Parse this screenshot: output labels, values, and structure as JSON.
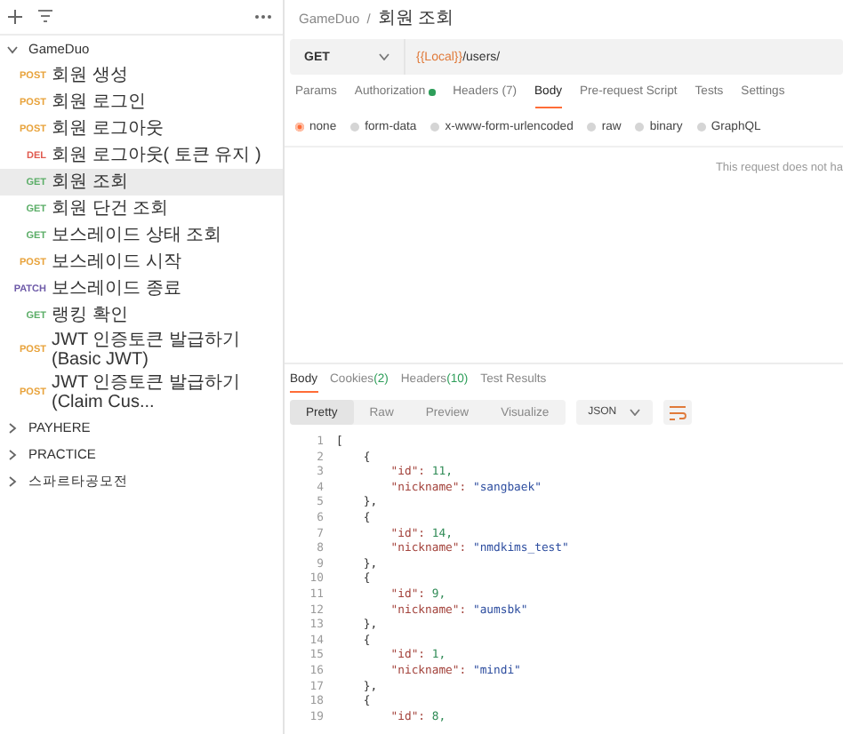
{
  "sidebar": {
    "collections": [
      {
        "name": "GameDuo",
        "expanded": true,
        "children": [
          {
            "method": "POST",
            "color": "#e8a33c",
            "name": "회원 생성",
            "selected": false
          },
          {
            "method": "POST",
            "color": "#e8a33c",
            "name": "회원 로그인",
            "selected": false
          },
          {
            "method": "POST",
            "color": "#e8a33c",
            "name": "회원 로그아웃",
            "selected": false
          },
          {
            "method": "DEL",
            "color": "#e05a4f",
            "name": "회원 로그아웃( 토큰 유지 )",
            "selected": false
          },
          {
            "method": "GET",
            "color": "#5cae68",
            "name": "회원 조회",
            "selected": true
          },
          {
            "method": "GET",
            "color": "#5cae68",
            "name": "회원 단건 조회",
            "selected": false
          },
          {
            "method": "GET",
            "color": "#5cae68",
            "name": "보스레이드 상태 조회",
            "selected": false
          },
          {
            "method": "POST",
            "color": "#e8a33c",
            "name": "보스레이드 시작",
            "selected": false
          },
          {
            "method": "PATCH",
            "color": "#6e5aa8",
            "name": "보스레이드 종료",
            "selected": false
          },
          {
            "method": "GET",
            "color": "#5cae68",
            "name": "랭킹 확인",
            "selected": false
          },
          {
            "method": "POST",
            "color": "#e8a33c",
            "name": "JWT 인증토큰 발급하기(Basic JWT)",
            "selected": false
          },
          {
            "method": "POST",
            "color": "#e8a33c",
            "name": "JWT 인증토큰 발급하기(Claim Cus...",
            "selected": false
          }
        ]
      },
      {
        "name": "PAYHERE",
        "expanded": false
      },
      {
        "name": "PRACTICE",
        "expanded": false
      },
      {
        "name": "스파르타공모전",
        "expanded": false
      }
    ]
  },
  "breadcrumb": {
    "parent": "GameDuo",
    "separator": "/",
    "current": "회원 조회"
  },
  "request": {
    "method": "GET",
    "url_variable": "{{Local}}",
    "url_path": "/users/"
  },
  "request_tabs": [
    {
      "label": "Params",
      "selected": false,
      "indicator": false
    },
    {
      "label": "Authorization",
      "selected": false,
      "indicator": true
    },
    {
      "label": "Headers (7)",
      "selected": false,
      "indicator": false
    },
    {
      "label": "Body",
      "selected": true,
      "indicator": false
    },
    {
      "label": "Pre-request Script",
      "selected": false,
      "indicator": false
    },
    {
      "label": "Tests",
      "selected": false,
      "indicator": false
    },
    {
      "label": "Settings",
      "selected": false,
      "indicator": false
    }
  ],
  "body_types": [
    {
      "label": "none",
      "selected": true
    },
    {
      "label": "form-data",
      "selected": false
    },
    {
      "label": "x-www-form-urlencoded",
      "selected": false
    },
    {
      "label": "raw",
      "selected": false
    },
    {
      "label": "binary",
      "selected": false
    },
    {
      "label": "GraphQL",
      "selected": false
    }
  ],
  "body_message": "This request does not ha",
  "response_tabs": [
    {
      "label": "Body",
      "selected": true
    },
    {
      "label": "Cookies",
      "count": "(2)",
      "selected": false
    },
    {
      "label": "Headers",
      "count": "(10)",
      "selected": false
    },
    {
      "label": "Test Results",
      "selected": false
    }
  ],
  "view_modes": [
    {
      "label": "Pretty",
      "selected": true
    },
    {
      "label": "Raw",
      "selected": false
    },
    {
      "label": "Preview",
      "selected": false
    },
    {
      "label": "Visualize",
      "selected": false
    }
  ],
  "format": "JSON",
  "code_lines": [
    {
      "no": "1",
      "kind": "punct",
      "text": "["
    },
    {
      "no": "2",
      "kind": "punct",
      "text": "    {"
    },
    {
      "no": "3",
      "kind": "pair",
      "key": "        \"id\":",
      "value": "11,",
      "color": "#2e8a55"
    },
    {
      "no": "4",
      "kind": "pair",
      "key": "        \"nickname\":",
      "value": "\"sangbaek\"",
      "color": "#2f4fa0"
    },
    {
      "no": "5",
      "kind": "punct",
      "text": "    },"
    },
    {
      "no": "6",
      "kind": "punct",
      "text": "    {"
    },
    {
      "no": "7",
      "kind": "pair",
      "key": "        \"id\":",
      "value": "14,",
      "color": "#2e8a55"
    },
    {
      "no": "8",
      "kind": "pair",
      "key": "        \"nickname\":",
      "value": "\"nmdkims_test\"",
      "color": "#2f4fa0"
    },
    {
      "no": "9",
      "kind": "punct",
      "text": "    },"
    },
    {
      "no": "10",
      "kind": "punct",
      "text": "    {"
    },
    {
      "no": "11",
      "kind": "pair",
      "key": "        \"id\":",
      "value": "9,",
      "color": "#2e8a55"
    },
    {
      "no": "12",
      "kind": "pair",
      "key": "        \"nickname\":",
      "value": "\"aumsbk\"",
      "color": "#2f4fa0"
    },
    {
      "no": "13",
      "kind": "punct",
      "text": "    },"
    },
    {
      "no": "14",
      "kind": "punct",
      "text": "    {"
    },
    {
      "no": "15",
      "kind": "pair",
      "key": "        \"id\":",
      "value": "1,",
      "color": "#2e8a55"
    },
    {
      "no": "16",
      "kind": "pair",
      "key": "        \"nickname\":",
      "value": "\"mindi\"",
      "color": "#2f4fa0"
    },
    {
      "no": "17",
      "kind": "punct",
      "text": "    },"
    },
    {
      "no": "18",
      "kind": "punct",
      "text": "    {"
    },
    {
      "no": "19",
      "kind": "pair",
      "key": "        \"id\":",
      "value": "8,",
      "color": "#2e8a55"
    }
  ]
}
